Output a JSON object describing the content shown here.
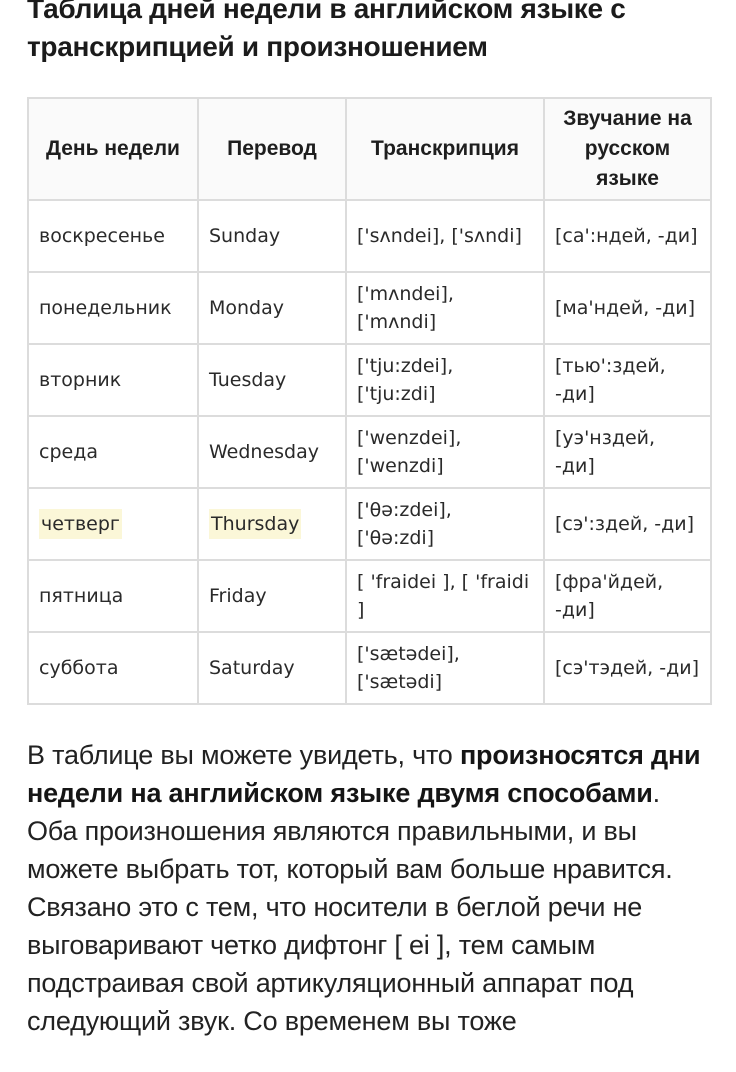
{
  "title": "Таблица дней недели в английском языке с транскрипцией и произношением",
  "table": {
    "headers": [
      "День недели",
      "Перевод",
      "Транскрипция",
      "Звучание на русском языке"
    ],
    "rows": [
      {
        "ru": "воскресенье",
        "en": "Sunday",
        "transcription": "['sʌndei], ['sʌndi]",
        "sound": "[са':ндей, -ди]",
        "highlighted": false
      },
      {
        "ru": "понедельник",
        "en": "Monday",
        "transcription": "['mʌndei], ['mʌndi]",
        "sound": "[ма'ндей, -ди]",
        "highlighted": false
      },
      {
        "ru": "вторник",
        "en": "Tuesday",
        "transcription": "['tju:zdei], ['tju:zdi]",
        "sound": "[тью':здей, -ди]",
        "highlighted": false
      },
      {
        "ru": "среда",
        "en": "Wednesday",
        "transcription": "['wenzdei], ['wenzdi]",
        "sound": "[уэ'нздей, -ди]",
        "highlighted": false
      },
      {
        "ru": "четверг",
        "en": "Thursday",
        "transcription": "['θə:zdei], ['θə:zdi]",
        "sound": "[сэ':здей, -ди]",
        "highlighted": true
      },
      {
        "ru": "пятница",
        "en": "Friday",
        "transcription": "[ 'fraidei ], [ 'fraidi ]",
        "sound": "[фра'йдей, -ди]",
        "highlighted": false
      },
      {
        "ru": "суббота",
        "en": "Saturday",
        "transcription": "['sætədei], ['sætədi]",
        "sound": "[сэ'тэдей, -ди]",
        "highlighted": false
      }
    ]
  },
  "paragraph": {
    "part1": "В таблице вы можете увидеть, что ",
    "bold": "произносятся дни недели на английском языке двумя способами",
    "part2": ". Оба произношения являются правильными, и вы можете выбрать тот, который вам больше нравится. Связано это с тем, что носители в беглой речи не выговаривают четко дифтонг [ ei ], тем самым подстраивая свой артикуляционный аппарат под следующий звук. Со временем вы тоже"
  },
  "colors": {
    "highlight": "#fbf7d8",
    "border": "#dcdcdc",
    "text": "#1a1a1a"
  }
}
